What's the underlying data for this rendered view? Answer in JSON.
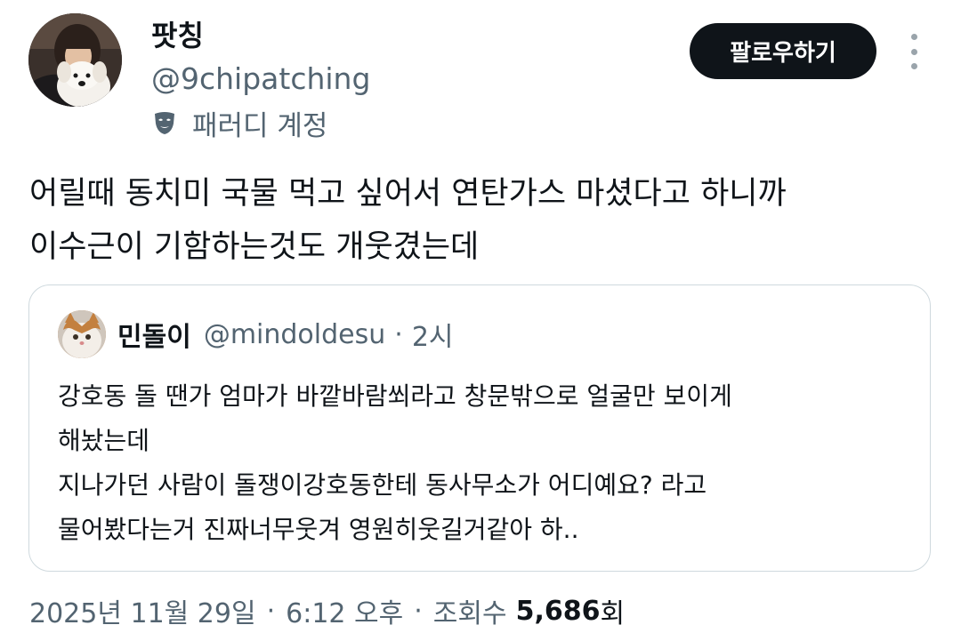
{
  "author": {
    "display_name": "팟칭",
    "handle": "@9chipatching",
    "parody_label": "패러디 계정",
    "parody_icon": "parody-mask-icon",
    "avatar_icon": "avatar-person-with-dog"
  },
  "follow_button": {
    "label": "팔로우하기"
  },
  "more_menu": {
    "icon": "more-vertical-icon"
  },
  "tweet": {
    "lines": [
      "어릴때 동치미 국물 먹고 싶어서 연탄가스 마셨다고 하니까",
      "이수근이 기함하는것도 개웃겼는데"
    ]
  },
  "quote": {
    "display_name": "민돌이",
    "handle": "@mindoldesu",
    "separator": "·",
    "time": "2시",
    "avatar_icon": "avatar-cat",
    "lines": [
      "강호동 돌 땐가 엄마가 바깥바람쐬라고 창문밖으로 얼굴만 보이게",
      "해놨는데",
      "지나가던 사람이 돌쟁이강호동한테 동사무소가 어디예요? 라고",
      "물어봤다는거 진짜너무웃겨 영원히웃길거같아  하.."
    ]
  },
  "meta": {
    "date": "2025년 11월 29일",
    "separator": "·",
    "time": "6:12 오후",
    "views_label": "조회수",
    "views_count": "5,686",
    "views_suffix": "회"
  },
  "colors": {
    "text_primary": "#0f1419",
    "text_secondary": "#536471",
    "border": "#cfd9de",
    "button_bg": "#0f1419",
    "button_text": "#ffffff"
  }
}
